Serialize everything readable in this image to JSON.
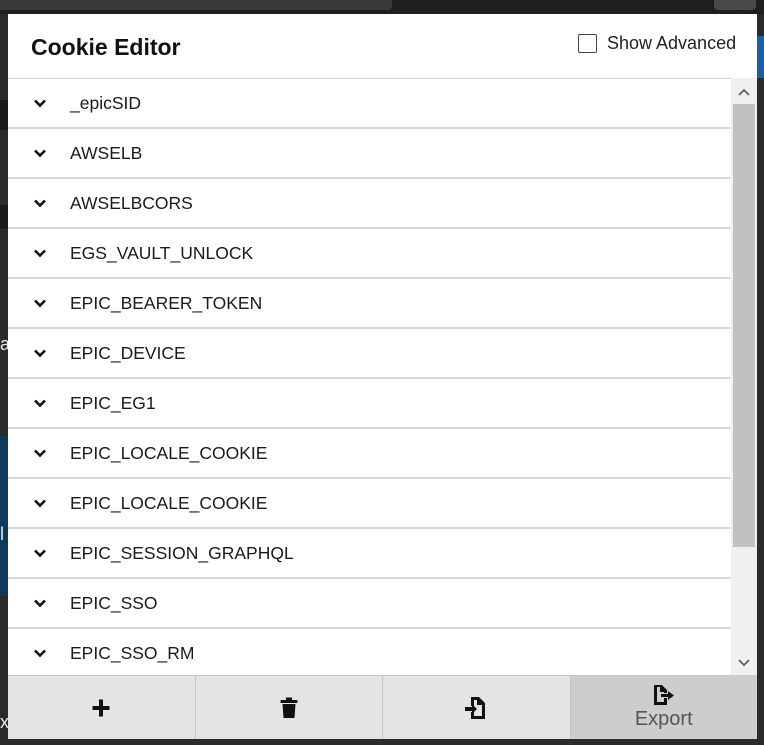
{
  "popup": {
    "title": "Cookie Editor",
    "show_advanced_label": "Show Advanced",
    "show_advanced_checked": false
  },
  "cookies": [
    {
      "name": "_epicSID"
    },
    {
      "name": "AWSELB"
    },
    {
      "name": "AWSELBCORS"
    },
    {
      "name": "EGS_VAULT_UNLOCK"
    },
    {
      "name": "EPIC_BEARER_TOKEN"
    },
    {
      "name": "EPIC_DEVICE"
    },
    {
      "name": "EPIC_EG1"
    },
    {
      "name": "EPIC_LOCALE_COOKIE"
    },
    {
      "name": "EPIC_LOCALE_COOKIE"
    },
    {
      "name": "EPIC_SESSION_GRAPHQL"
    },
    {
      "name": "EPIC_SSO"
    },
    {
      "name": "EPIC_SSO_RM"
    }
  ],
  "footer": {
    "add_icon": "plus-icon",
    "delete_icon": "trash-icon",
    "import_icon": "import-icon",
    "export_icon": "export-icon",
    "export_label": "Export"
  },
  "background": {
    "edge_letters": [
      "a",
      "l",
      "x"
    ]
  },
  "colors": {
    "popup_bg": "#ffffff",
    "row_divider": "#d9d9d9",
    "footer_bg": "#e4e4e4",
    "footer_active_bg": "#cdcdcd",
    "page_bg": "#2b2b2b"
  }
}
